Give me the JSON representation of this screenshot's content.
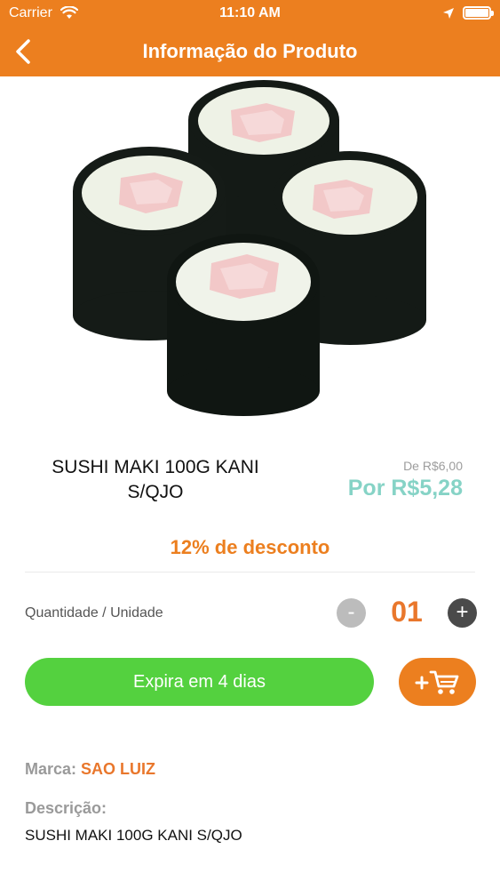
{
  "status_bar": {
    "carrier": "Carrier",
    "time": "11:10 AM"
  },
  "header": {
    "title": "Informação do Produto"
  },
  "product": {
    "image_icon": "sushi-maki-photo",
    "name": "SUSHI MAKI 100G KANI S/QJO",
    "old_price": "De R$6,00",
    "new_price": "Por R$5,28",
    "discount": "12% de desconto"
  },
  "quantity": {
    "label": "Quantidade / Unidade",
    "minus": "-",
    "value": "01",
    "plus": "+"
  },
  "actions": {
    "expire_label": "Expira em 4 dias",
    "cart_icon": "add-to-cart-icon"
  },
  "details": {
    "brand_label": "Marca:",
    "brand_value": "SAO LUIZ",
    "description_label": "Descrição:",
    "description_text": "SUSHI MAKI 100G KANI S/QJO"
  },
  "colors": {
    "accent": "#ec7f1f",
    "price_teal": "#86d3c6",
    "expire_green": "#54d13f"
  }
}
